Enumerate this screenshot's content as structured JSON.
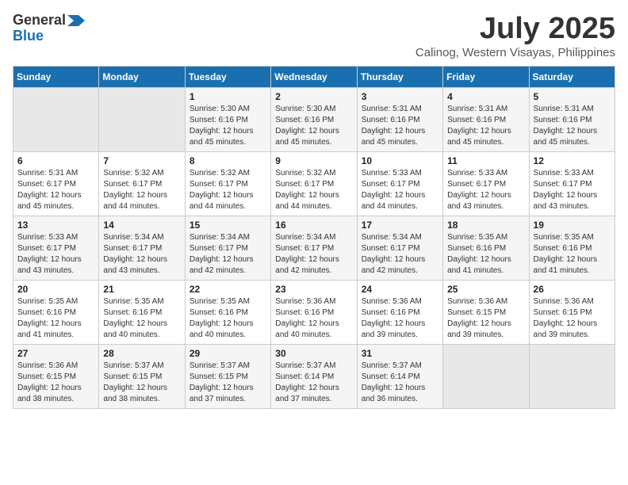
{
  "header": {
    "logo_general": "General",
    "logo_blue": "Blue",
    "month": "July 2025",
    "location": "Calinog, Western Visayas, Philippines"
  },
  "weekdays": [
    "Sunday",
    "Monday",
    "Tuesday",
    "Wednesday",
    "Thursday",
    "Friday",
    "Saturday"
  ],
  "weeks": [
    [
      {
        "day": "",
        "info": ""
      },
      {
        "day": "",
        "info": ""
      },
      {
        "day": "1",
        "info": "Sunrise: 5:30 AM\nSunset: 6:16 PM\nDaylight: 12 hours and 45 minutes."
      },
      {
        "day": "2",
        "info": "Sunrise: 5:30 AM\nSunset: 6:16 PM\nDaylight: 12 hours and 45 minutes."
      },
      {
        "day": "3",
        "info": "Sunrise: 5:31 AM\nSunset: 6:16 PM\nDaylight: 12 hours and 45 minutes."
      },
      {
        "day": "4",
        "info": "Sunrise: 5:31 AM\nSunset: 6:16 PM\nDaylight: 12 hours and 45 minutes."
      },
      {
        "day": "5",
        "info": "Sunrise: 5:31 AM\nSunset: 6:16 PM\nDaylight: 12 hours and 45 minutes."
      }
    ],
    [
      {
        "day": "6",
        "info": "Sunrise: 5:31 AM\nSunset: 6:17 PM\nDaylight: 12 hours and 45 minutes."
      },
      {
        "day": "7",
        "info": "Sunrise: 5:32 AM\nSunset: 6:17 PM\nDaylight: 12 hours and 44 minutes."
      },
      {
        "day": "8",
        "info": "Sunrise: 5:32 AM\nSunset: 6:17 PM\nDaylight: 12 hours and 44 minutes."
      },
      {
        "day": "9",
        "info": "Sunrise: 5:32 AM\nSunset: 6:17 PM\nDaylight: 12 hours and 44 minutes."
      },
      {
        "day": "10",
        "info": "Sunrise: 5:33 AM\nSunset: 6:17 PM\nDaylight: 12 hours and 44 minutes."
      },
      {
        "day": "11",
        "info": "Sunrise: 5:33 AM\nSunset: 6:17 PM\nDaylight: 12 hours and 43 minutes."
      },
      {
        "day": "12",
        "info": "Sunrise: 5:33 AM\nSunset: 6:17 PM\nDaylight: 12 hours and 43 minutes."
      }
    ],
    [
      {
        "day": "13",
        "info": "Sunrise: 5:33 AM\nSunset: 6:17 PM\nDaylight: 12 hours and 43 minutes."
      },
      {
        "day": "14",
        "info": "Sunrise: 5:34 AM\nSunset: 6:17 PM\nDaylight: 12 hours and 43 minutes."
      },
      {
        "day": "15",
        "info": "Sunrise: 5:34 AM\nSunset: 6:17 PM\nDaylight: 12 hours and 42 minutes."
      },
      {
        "day": "16",
        "info": "Sunrise: 5:34 AM\nSunset: 6:17 PM\nDaylight: 12 hours and 42 minutes."
      },
      {
        "day": "17",
        "info": "Sunrise: 5:34 AM\nSunset: 6:17 PM\nDaylight: 12 hours and 42 minutes."
      },
      {
        "day": "18",
        "info": "Sunrise: 5:35 AM\nSunset: 6:16 PM\nDaylight: 12 hours and 41 minutes."
      },
      {
        "day": "19",
        "info": "Sunrise: 5:35 AM\nSunset: 6:16 PM\nDaylight: 12 hours and 41 minutes."
      }
    ],
    [
      {
        "day": "20",
        "info": "Sunrise: 5:35 AM\nSunset: 6:16 PM\nDaylight: 12 hours and 41 minutes."
      },
      {
        "day": "21",
        "info": "Sunrise: 5:35 AM\nSunset: 6:16 PM\nDaylight: 12 hours and 40 minutes."
      },
      {
        "day": "22",
        "info": "Sunrise: 5:35 AM\nSunset: 6:16 PM\nDaylight: 12 hours and 40 minutes."
      },
      {
        "day": "23",
        "info": "Sunrise: 5:36 AM\nSunset: 6:16 PM\nDaylight: 12 hours and 40 minutes."
      },
      {
        "day": "24",
        "info": "Sunrise: 5:36 AM\nSunset: 6:16 PM\nDaylight: 12 hours and 39 minutes."
      },
      {
        "day": "25",
        "info": "Sunrise: 5:36 AM\nSunset: 6:15 PM\nDaylight: 12 hours and 39 minutes."
      },
      {
        "day": "26",
        "info": "Sunrise: 5:36 AM\nSunset: 6:15 PM\nDaylight: 12 hours and 39 minutes."
      }
    ],
    [
      {
        "day": "27",
        "info": "Sunrise: 5:36 AM\nSunset: 6:15 PM\nDaylight: 12 hours and 38 minutes."
      },
      {
        "day": "28",
        "info": "Sunrise: 5:37 AM\nSunset: 6:15 PM\nDaylight: 12 hours and 38 minutes."
      },
      {
        "day": "29",
        "info": "Sunrise: 5:37 AM\nSunset: 6:15 PM\nDaylight: 12 hours and 37 minutes."
      },
      {
        "day": "30",
        "info": "Sunrise: 5:37 AM\nSunset: 6:14 PM\nDaylight: 12 hours and 37 minutes."
      },
      {
        "day": "31",
        "info": "Sunrise: 5:37 AM\nSunset: 6:14 PM\nDaylight: 12 hours and 36 minutes."
      },
      {
        "day": "",
        "info": ""
      },
      {
        "day": "",
        "info": ""
      }
    ]
  ]
}
